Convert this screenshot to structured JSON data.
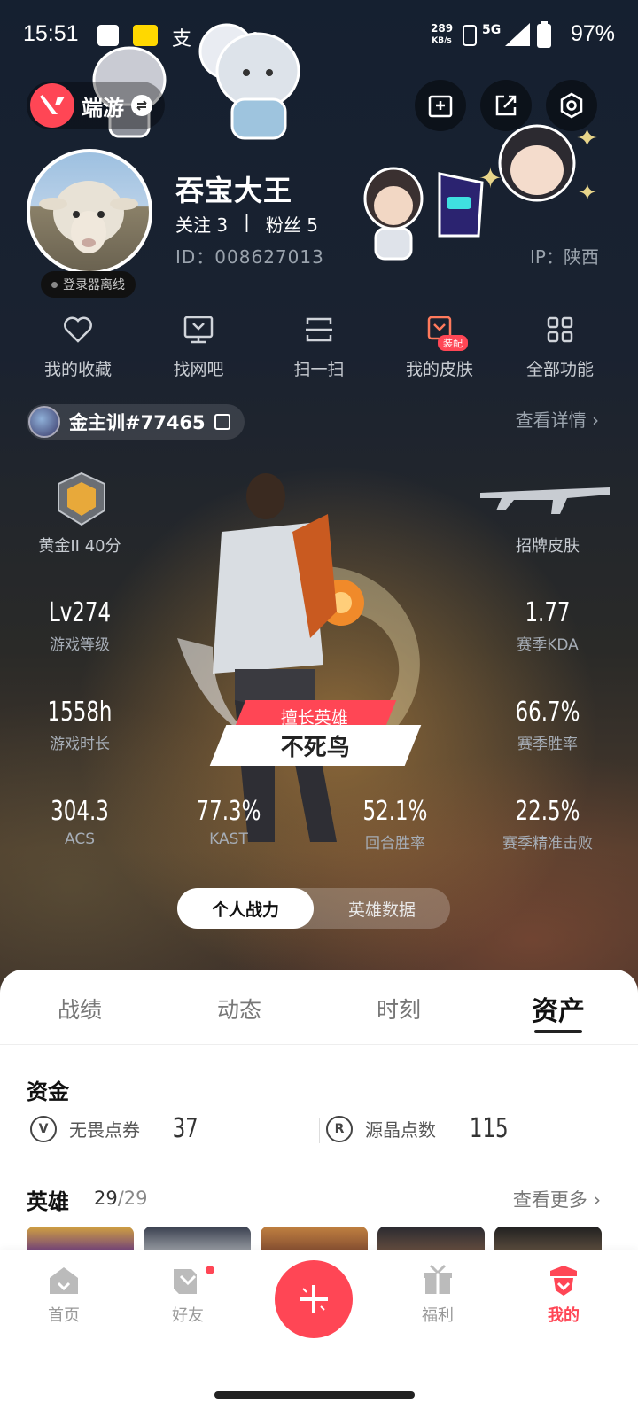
{
  "status_bar": {
    "time": "15:51",
    "net_speed": "289",
    "net_unit": "KB/s",
    "network": "5G",
    "battery": "97%"
  },
  "header": {
    "app_name": "端游",
    "icons": [
      "image-edit-icon",
      "share-icon",
      "settings-icon"
    ]
  },
  "profile": {
    "username": "吞宝大王",
    "following_label": "关注",
    "following": "3",
    "separator": "|",
    "followers_label": "粉丝",
    "followers": "5",
    "id_text": "ID：008627013",
    "ip_text": "IP：陕西",
    "login_status": "登录器离线"
  },
  "functions": [
    {
      "label": "我的收藏",
      "icon": "heart-icon"
    },
    {
      "label": "找网吧",
      "icon": "monitor-icon"
    },
    {
      "label": "扫一扫",
      "icon": "scan-icon"
    },
    {
      "label": "我的皮肤",
      "icon": "skin-icon",
      "badge": "装配"
    },
    {
      "label": "全部功能",
      "icon": "grid-icon"
    }
  ],
  "riot": {
    "id": "金主训#77465",
    "detail_link": "查看详情"
  },
  "stats": {
    "rank": "黄金II 40分",
    "skin_label": "招牌皮肤",
    "level_value": "Lv274",
    "level_label": "游戏等级",
    "kda_value": "1.77",
    "kda_label": "赛季KDA",
    "hours_value": "1558h",
    "hours_label": "游戏时长",
    "winrate_value": "66.7%",
    "winrate_label": "赛季胜率",
    "acs_value": "304.3",
    "acs_label": "ACS",
    "kast_value": "77.3%",
    "kast_label": "KAST",
    "round_value": "52.1%",
    "round_label": "回合胜率",
    "precise_value": "22.5%",
    "precise_label": "赛季精准击败"
  },
  "best_agent": {
    "tag": "擅长英雄",
    "name": "不死鸟"
  },
  "toggle": {
    "active": "个人战力",
    "inactive": "英雄数据"
  },
  "tabs": [
    "战绩",
    "动态",
    "时刻",
    "资产"
  ],
  "assets": {
    "funds_title": "资金",
    "vp_label": "无畏点券",
    "vp_value": "37",
    "rp_label": "源晶点数",
    "rp_value": "115",
    "heroes_title": "英雄",
    "heroes_count": "29",
    "heroes_total": "/29",
    "more_link": "查看更多"
  },
  "nav": [
    {
      "label": "首页",
      "icon": "home-icon"
    },
    {
      "label": "好友",
      "icon": "friends-icon"
    },
    {
      "label": "福利",
      "icon": "gift-icon"
    },
    {
      "label": "我的",
      "icon": "profile-icon"
    }
  ],
  "colors": {
    "accent": "#ff4655",
    "sheet_bg": "#ffffff"
  }
}
